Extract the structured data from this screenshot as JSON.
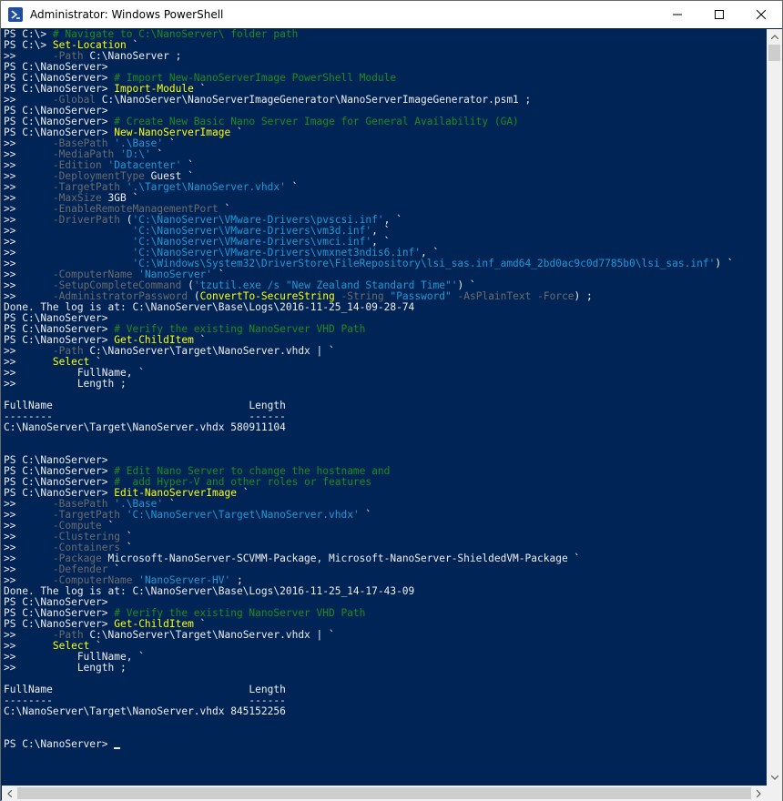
{
  "window": {
    "title": "Administrator: Windows PowerShell",
    "icon": "powershell-icon",
    "controls": [
      "minimize-icon",
      "maximize-icon",
      "close-icon"
    ]
  },
  "colors": {
    "console_bg": "#012456",
    "text": "#eeedf0",
    "comment": "#1e8c1e",
    "command": "#ffff00",
    "string": "#1e9ad6",
    "parameter": "#6c6c6c"
  },
  "console": {
    "lines": [
      [
        [
          "PS C:\\> ",
          ""
        ],
        [
          "# Navigate to C:\\NanoServer\\ folder path",
          "g"
        ]
      ],
      [
        [
          "PS C:\\> ",
          ""
        ],
        [
          "Set-Location",
          "y"
        ],
        [
          " `",
          ""
        ]
      ],
      [
        [
          ">>      ",
          ""
        ],
        [
          "-Path",
          "gr"
        ],
        [
          " C:\\NanoServer ;",
          ""
        ]
      ],
      [
        [
          "PS C:\\NanoServer>",
          ""
        ]
      ],
      [
        [
          "PS C:\\NanoServer> ",
          ""
        ],
        [
          "# Import New-NanoServerImage PowerShell Module",
          "g"
        ]
      ],
      [
        [
          "PS C:\\NanoServer> ",
          ""
        ],
        [
          "Import-Module",
          "y"
        ],
        [
          " `",
          ""
        ]
      ],
      [
        [
          ">>      ",
          ""
        ],
        [
          "-Global",
          "gr"
        ],
        [
          " C:\\NanoServer\\NanoServerImageGenerator\\NanoServerImageGenerator.psm1 ;",
          ""
        ]
      ],
      [
        [
          "PS C:\\NanoServer>",
          ""
        ]
      ],
      [
        [
          "PS C:\\NanoServer> ",
          ""
        ],
        [
          "# Create New Basic Nano Server Image for General Availability (GA)",
          "g"
        ]
      ],
      [
        [
          "PS C:\\NanoServer> ",
          ""
        ],
        [
          "New-NanoServerImage",
          "y"
        ],
        [
          " `",
          ""
        ]
      ],
      [
        [
          ">>      ",
          ""
        ],
        [
          "-BasePath",
          "gr"
        ],
        [
          " ",
          ""
        ],
        [
          "'.\\Base'",
          "d"
        ],
        [
          " `",
          ""
        ]
      ],
      [
        [
          ">>      ",
          ""
        ],
        [
          "-MediaPath",
          "gr"
        ],
        [
          " ",
          ""
        ],
        [
          "'D:\\'",
          "d"
        ],
        [
          " `",
          ""
        ]
      ],
      [
        [
          ">>      ",
          ""
        ],
        [
          "-Edition",
          "gr"
        ],
        [
          " ",
          ""
        ],
        [
          "'Datacenter'",
          "d"
        ],
        [
          " `",
          ""
        ]
      ],
      [
        [
          ">>      ",
          ""
        ],
        [
          "-DeploymentType",
          "gr"
        ],
        [
          " Guest `",
          ""
        ]
      ],
      [
        [
          ">>      ",
          ""
        ],
        [
          "-TargetPath",
          "gr"
        ],
        [
          " ",
          ""
        ],
        [
          "'.\\Target\\NanoServer.vhdx'",
          "d"
        ],
        [
          " `",
          ""
        ]
      ],
      [
        [
          ">>      ",
          ""
        ],
        [
          "-MaxSize",
          "gr"
        ],
        [
          " 3GB `",
          ""
        ]
      ],
      [
        [
          ">>      ",
          ""
        ],
        [
          "-EnableRemoteManagementPort",
          "gr"
        ],
        [
          " `",
          ""
        ]
      ],
      [
        [
          ">>      ",
          ""
        ],
        [
          "-DriverPath",
          "gr"
        ],
        [
          " (",
          ""
        ],
        [
          "'C:\\NanoServer\\VMware-Drivers\\pvscsi.inf'",
          "d"
        ],
        [
          ", `",
          ""
        ]
      ],
      [
        [
          ">>                   ",
          ""
        ],
        [
          "'C:\\NanoServer\\VMware-Drivers\\vm3d.inf'",
          "d"
        ],
        [
          ", `",
          ""
        ]
      ],
      [
        [
          ">>                   ",
          ""
        ],
        [
          "'C:\\NanoServer\\VMware-Drivers\\vmci.inf'",
          "d"
        ],
        [
          ", `",
          ""
        ]
      ],
      [
        [
          ">>                   ",
          ""
        ],
        [
          "'C:\\NanoServer\\VMware-Drivers\\vmxnet3ndis6.inf'",
          "d"
        ],
        [
          ", `",
          ""
        ]
      ],
      [
        [
          ">>                   ",
          ""
        ],
        [
          "'C:\\Windows\\System32\\DriverStore\\FileRepository\\lsi_sas.inf_amd64_2bd0ac9c0d7785b0\\lsi_sas.inf'",
          "d"
        ],
        [
          ") `",
          ""
        ]
      ],
      [
        [
          ">>      ",
          ""
        ],
        [
          "-ComputerName",
          "gr"
        ],
        [
          " ",
          ""
        ],
        [
          "'NanoServer'",
          "d"
        ],
        [
          " `",
          ""
        ]
      ],
      [
        [
          ">>      ",
          ""
        ],
        [
          "-SetupCompleteCommand",
          "gr"
        ],
        [
          " (",
          ""
        ],
        [
          "'tzutil.exe /s \"New Zealand Standard Time\"'",
          "d"
        ],
        [
          ") `",
          ""
        ]
      ],
      [
        [
          ">>      ",
          ""
        ],
        [
          "-AdministratorPassword",
          "gr"
        ],
        [
          " (",
          ""
        ],
        [
          "ConvertTo-SecureString",
          "y"
        ],
        [
          " ",
          ""
        ],
        [
          "-String",
          "gr"
        ],
        [
          " ",
          ""
        ],
        [
          "\"Password\"",
          "d"
        ],
        [
          " ",
          ""
        ],
        [
          "-AsPlainText",
          "gr"
        ],
        [
          " ",
          ""
        ],
        [
          "-Force",
          "gr"
        ],
        [
          ") ;",
          ""
        ]
      ],
      [
        [
          "Done. The log is at: C:\\NanoServer\\Base\\Logs\\2016-11-25_14-09-28-74",
          ""
        ]
      ],
      [
        [
          "PS C:\\NanoServer>",
          ""
        ]
      ],
      [
        [
          "PS C:\\NanoServer> ",
          ""
        ],
        [
          "# Verify the existing NanoServer VHD Path",
          "g"
        ]
      ],
      [
        [
          "PS C:\\NanoServer> ",
          ""
        ],
        [
          "Get-ChildItem",
          "y"
        ],
        [
          " `",
          ""
        ]
      ],
      [
        [
          ">>      ",
          ""
        ],
        [
          "-Path",
          "gr"
        ],
        [
          " C:\\NanoServer\\Target\\NanoServer.vhdx | `",
          ""
        ]
      ],
      [
        [
          ">>      ",
          ""
        ],
        [
          "Select",
          "y"
        ],
        [
          " `",
          ""
        ]
      ],
      [
        [
          ">>          FullName, `",
          ""
        ]
      ],
      [
        [
          ">>          Length ;",
          ""
        ]
      ],
      [
        [
          "",
          ""
        ]
      ],
      [
        [
          "FullName                                Length",
          ""
        ]
      ],
      [
        [
          "--------                                ------",
          ""
        ]
      ],
      [
        [
          "C:\\NanoServer\\Target\\NanoServer.vhdx 580911104",
          ""
        ]
      ],
      [
        [
          "",
          ""
        ]
      ],
      [
        [
          "",
          ""
        ]
      ],
      [
        [
          "PS C:\\NanoServer>",
          ""
        ]
      ],
      [
        [
          "PS C:\\NanoServer> ",
          ""
        ],
        [
          "# Edit Nano Server to change the hostname and",
          "g"
        ]
      ],
      [
        [
          "PS C:\\NanoServer> ",
          ""
        ],
        [
          "#  add Hyper-V and other roles or features",
          "g"
        ]
      ],
      [
        [
          "PS C:\\NanoServer> ",
          ""
        ],
        [
          "Edit-NanoServerImage",
          "y"
        ],
        [
          " `",
          ""
        ]
      ],
      [
        [
          ">>      ",
          ""
        ],
        [
          "-BasePath",
          "gr"
        ],
        [
          " ",
          ""
        ],
        [
          "'.\\Base'",
          "d"
        ],
        [
          " `",
          ""
        ]
      ],
      [
        [
          ">>      ",
          ""
        ],
        [
          "-TargetPath",
          "gr"
        ],
        [
          " ",
          ""
        ],
        [
          "'C:\\NanoServer\\Target\\NanoServer.vhdx'",
          "d"
        ],
        [
          " `",
          ""
        ]
      ],
      [
        [
          ">>      ",
          ""
        ],
        [
          "-Compute",
          "gr"
        ],
        [
          " `",
          ""
        ]
      ],
      [
        [
          ">>      ",
          ""
        ],
        [
          "-Clustering",
          "gr"
        ],
        [
          " `",
          ""
        ]
      ],
      [
        [
          ">>      ",
          ""
        ],
        [
          "-Containers",
          "gr"
        ],
        [
          " `",
          ""
        ]
      ],
      [
        [
          ">>      ",
          ""
        ],
        [
          "-Package",
          "gr"
        ],
        [
          " Microsoft-NanoServer-SCVMM-Package, Microsoft-NanoServer-ShieldedVM-Package `",
          ""
        ]
      ],
      [
        [
          ">>      ",
          ""
        ],
        [
          "-Defender",
          "gr"
        ],
        [
          " `",
          ""
        ]
      ],
      [
        [
          ">>      ",
          ""
        ],
        [
          "-ComputerName",
          "gr"
        ],
        [
          " ",
          ""
        ],
        [
          "'NanoServer-HV'",
          "d"
        ],
        [
          " ;",
          ""
        ]
      ],
      [
        [
          "Done. The log is at: C:\\NanoServer\\Base\\Logs\\2016-11-25_14-17-43-09",
          ""
        ]
      ],
      [
        [
          "PS C:\\NanoServer>",
          ""
        ]
      ],
      [
        [
          "PS C:\\NanoServer> ",
          ""
        ],
        [
          "# Verify the existing NanoServer VHD Path",
          "g"
        ]
      ],
      [
        [
          "PS C:\\NanoServer> ",
          ""
        ],
        [
          "Get-ChildItem",
          "y"
        ],
        [
          " `",
          ""
        ]
      ],
      [
        [
          ">>      ",
          ""
        ],
        [
          "-Path",
          "gr"
        ],
        [
          " C:\\NanoServer\\Target\\NanoServer.vhdx | `",
          ""
        ]
      ],
      [
        [
          ">>      ",
          ""
        ],
        [
          "Select",
          "y"
        ],
        [
          " `",
          ""
        ]
      ],
      [
        [
          ">>          FullName, `",
          ""
        ]
      ],
      [
        [
          ">>          Length ;",
          ""
        ]
      ],
      [
        [
          "",
          ""
        ]
      ],
      [
        [
          "FullName                                Length",
          ""
        ]
      ],
      [
        [
          "--------                                ------",
          ""
        ]
      ],
      [
        [
          "C:\\NanoServer\\Target\\NanoServer.vhdx 845152256",
          ""
        ]
      ],
      [
        [
          "",
          ""
        ]
      ],
      [
        [
          "",
          ""
        ]
      ],
      [
        [
          "PS C:\\NanoServer> ",
          ""
        ]
      ]
    ]
  }
}
